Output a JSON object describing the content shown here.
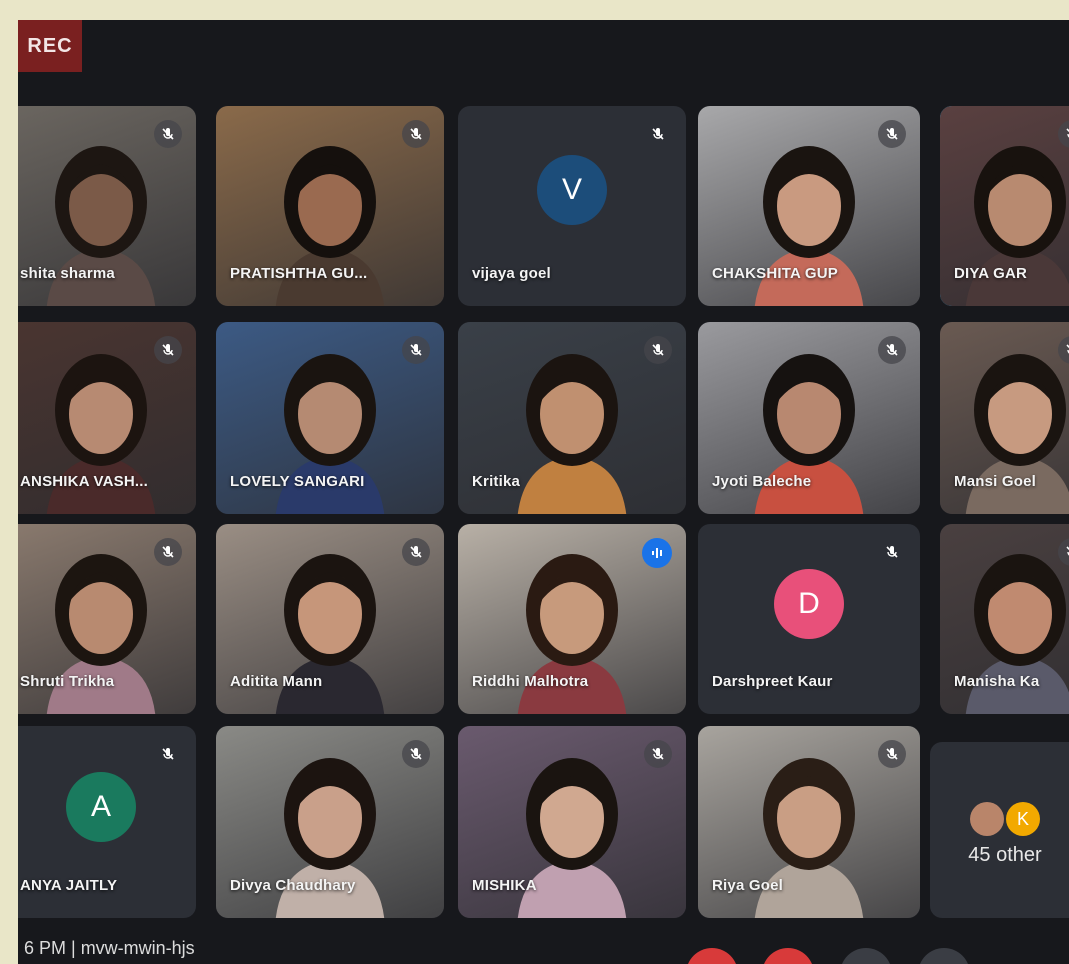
{
  "recording": {
    "label": "REC"
  },
  "participants": [
    {
      "name": "shita sharma",
      "bg": "#6b6660",
      "skin": "#7b5a48",
      "hair": "#1d1612",
      "shirt": "#5a4a46"
    },
    {
      "name": "PRATISHTHA GU...",
      "bg": "#8a6a4a",
      "skin": "#9a6a50",
      "hair": "#15100d",
      "shirt": "#4a3a30",
      "accent": "#c06030"
    },
    {
      "name": "vijaya goel",
      "avatar": "V",
      "avatar_color": "#1c4d7a"
    },
    {
      "name": "CHAKSHITA GUP",
      "bg": "#a8a8aa",
      "skin": "#c99a80",
      "hair": "#1a1410",
      "shirt": "#c46a5a"
    },
    {
      "name": "DIYA GAR",
      "bg": "#5a4040",
      "skin": "#b88a70",
      "hair": "#18120e",
      "shirt": "#4a3838",
      "active": true
    },
    {
      "name": "ANSHIKA VASH...",
      "bg": "#4a3530",
      "skin": "#b78a72",
      "hair": "#1c1410",
      "shirt": "#4a2a2a"
    },
    {
      "name": "LOVELY SANGARI",
      "bg": "#3c5a84",
      "skin": "#b58a72",
      "hair": "#1a1410",
      "shirt": "#2a3a6a"
    },
    {
      "name": "Kritika",
      "bg": "#3a4048",
      "skin": "#c09070",
      "hair": "#1b1410",
      "shirt": "#c08040"
    },
    {
      "name": "Jyoti Baleche",
      "bg": "#9a9a9e",
      "skin": "#b88870",
      "hair": "#161210",
      "shirt": "#c85040"
    },
    {
      "name": "Mansi Goel",
      "bg": "#6a5a52",
      "skin": "#c79a80",
      "hair": "#1a1410",
      "shirt": "#7a6a60"
    },
    {
      "name": "Shruti Trikha",
      "bg": "#8a7a6e",
      "skin": "#b88a70",
      "hair": "#1c1510",
      "shirt": "#a07a88"
    },
    {
      "name": "Aditita Mann",
      "bg": "#9a8e84",
      "skin": "#c6967a",
      "hair": "#1b1410",
      "shirt": "#2a2830"
    },
    {
      "name": "Riddhi Malhotra",
      "bg": "#b8b0a6",
      "skin": "#c79a7c",
      "hair": "#2a1a12",
      "shirt": "#8a3a40",
      "speaking": true
    },
    {
      "name": "Darshpreet Kaur",
      "avatar": "D",
      "avatar_color": "#e8507a"
    },
    {
      "name": "Manisha Ka",
      "bg": "#4a4040",
      "skin": "#c08a70",
      "hair": "#1a1410",
      "shirt": "#5a5a6a"
    },
    {
      "name": "ANYA JAITLY",
      "avatar": "A",
      "avatar_color": "#1a7a5e"
    },
    {
      "name": "Divya Chaudhary",
      "bg": "#8a8a86",
      "skin": "#c9a08a",
      "hair": "#1c1410",
      "shirt": "#c0b0a8"
    },
    {
      "name": "MISHIKA",
      "bg": "#6a5a6e",
      "skin": "#d0a890",
      "hair": "#1a1410",
      "shirt": "#c0a0b0"
    },
    {
      "name": "Riya Goel",
      "bg": "#a8a49e",
      "skin": "#c99e84",
      "hair": "#2a1e16",
      "shirt": "#b0a49a"
    }
  ],
  "others": {
    "label": "45 other",
    "badge": "K"
  },
  "bottom": {
    "time": "6 PM  |  mvw-mwin-hjs"
  }
}
